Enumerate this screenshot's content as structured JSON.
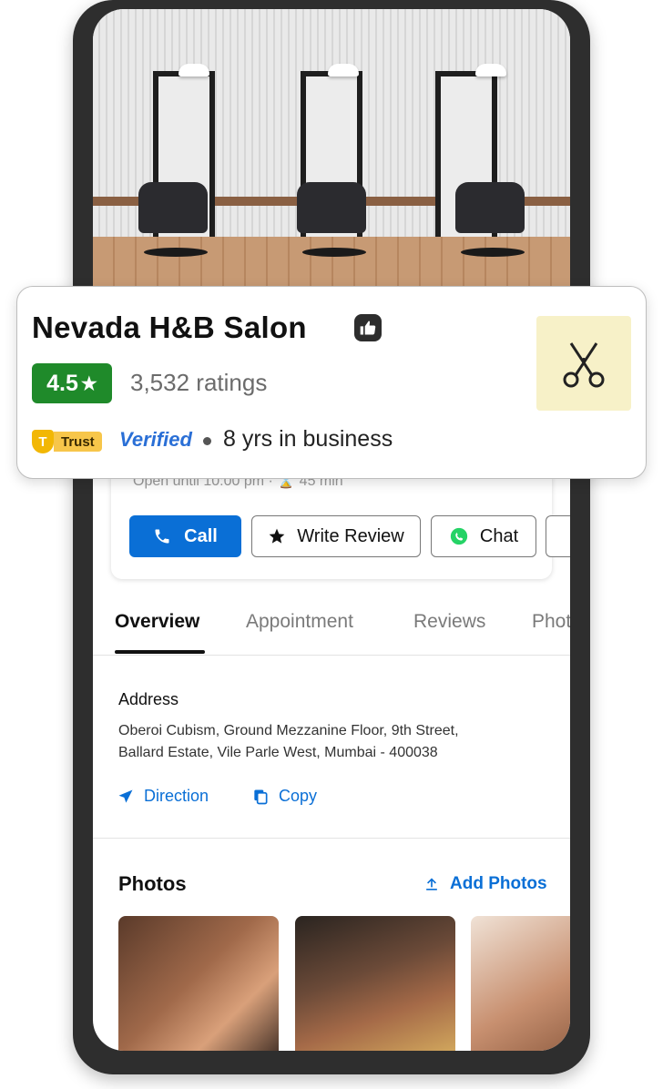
{
  "business": {
    "name": "Nevada H&B Salon",
    "rating": "4.5",
    "rating_star": "★",
    "rating_count": "3,532 ratings",
    "trust_label": "Trust",
    "verified_label": "Verified",
    "years": "8 yrs in business",
    "logo_icon": "scissors-icon"
  },
  "status": {
    "hours_text": "Open  until 10:00 pm  ·  ⌛ 45 min"
  },
  "actions": {
    "call": "Call",
    "write_review": "Write Review",
    "chat": "Chat"
  },
  "tabs": [
    "Overview",
    "Appointment",
    "Reviews",
    "Photos"
  ],
  "address": {
    "title": "Address",
    "line1": "Oberoi Cubism, Ground Mezzanine Floor, 9th Street,",
    "line2": "Ballard Estate, Vile Parle West, Mumbai - 400038",
    "direction": "Direction",
    "copy": "Copy"
  },
  "photos": {
    "title": "Photos",
    "add": "Add Photos"
  },
  "colors": {
    "brand_blue": "#0a6fd6",
    "rating_green": "#1f8a2a",
    "trust_yellow": "#f7c64a"
  }
}
